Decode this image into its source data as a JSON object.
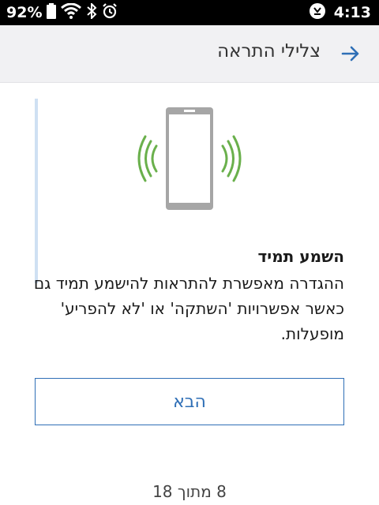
{
  "status_bar": {
    "battery_percent": "92%",
    "time": "4:13",
    "icons": [
      "battery-icon",
      "wifi-icon",
      "bluetooth-icon",
      "alarm-icon",
      "sync-icon"
    ]
  },
  "header": {
    "title": "צלילי התראה",
    "back_icon": "arrow-right-icon"
  },
  "main": {
    "illustration": "phone-vibrate-icon",
    "heading": "השמע תמיד",
    "description": "ההגדרה מאפשרת להתראות להישמע תמיד גם כאשר אפשרויות 'השתקה' או 'לא להפריע' מופעלות.",
    "next_label": "הבא",
    "pager": "8 מתוך 18"
  },
  "colors": {
    "accent": "#2f6fb6",
    "vibration": "#6ab04c",
    "phone": "#a6a6a6"
  }
}
